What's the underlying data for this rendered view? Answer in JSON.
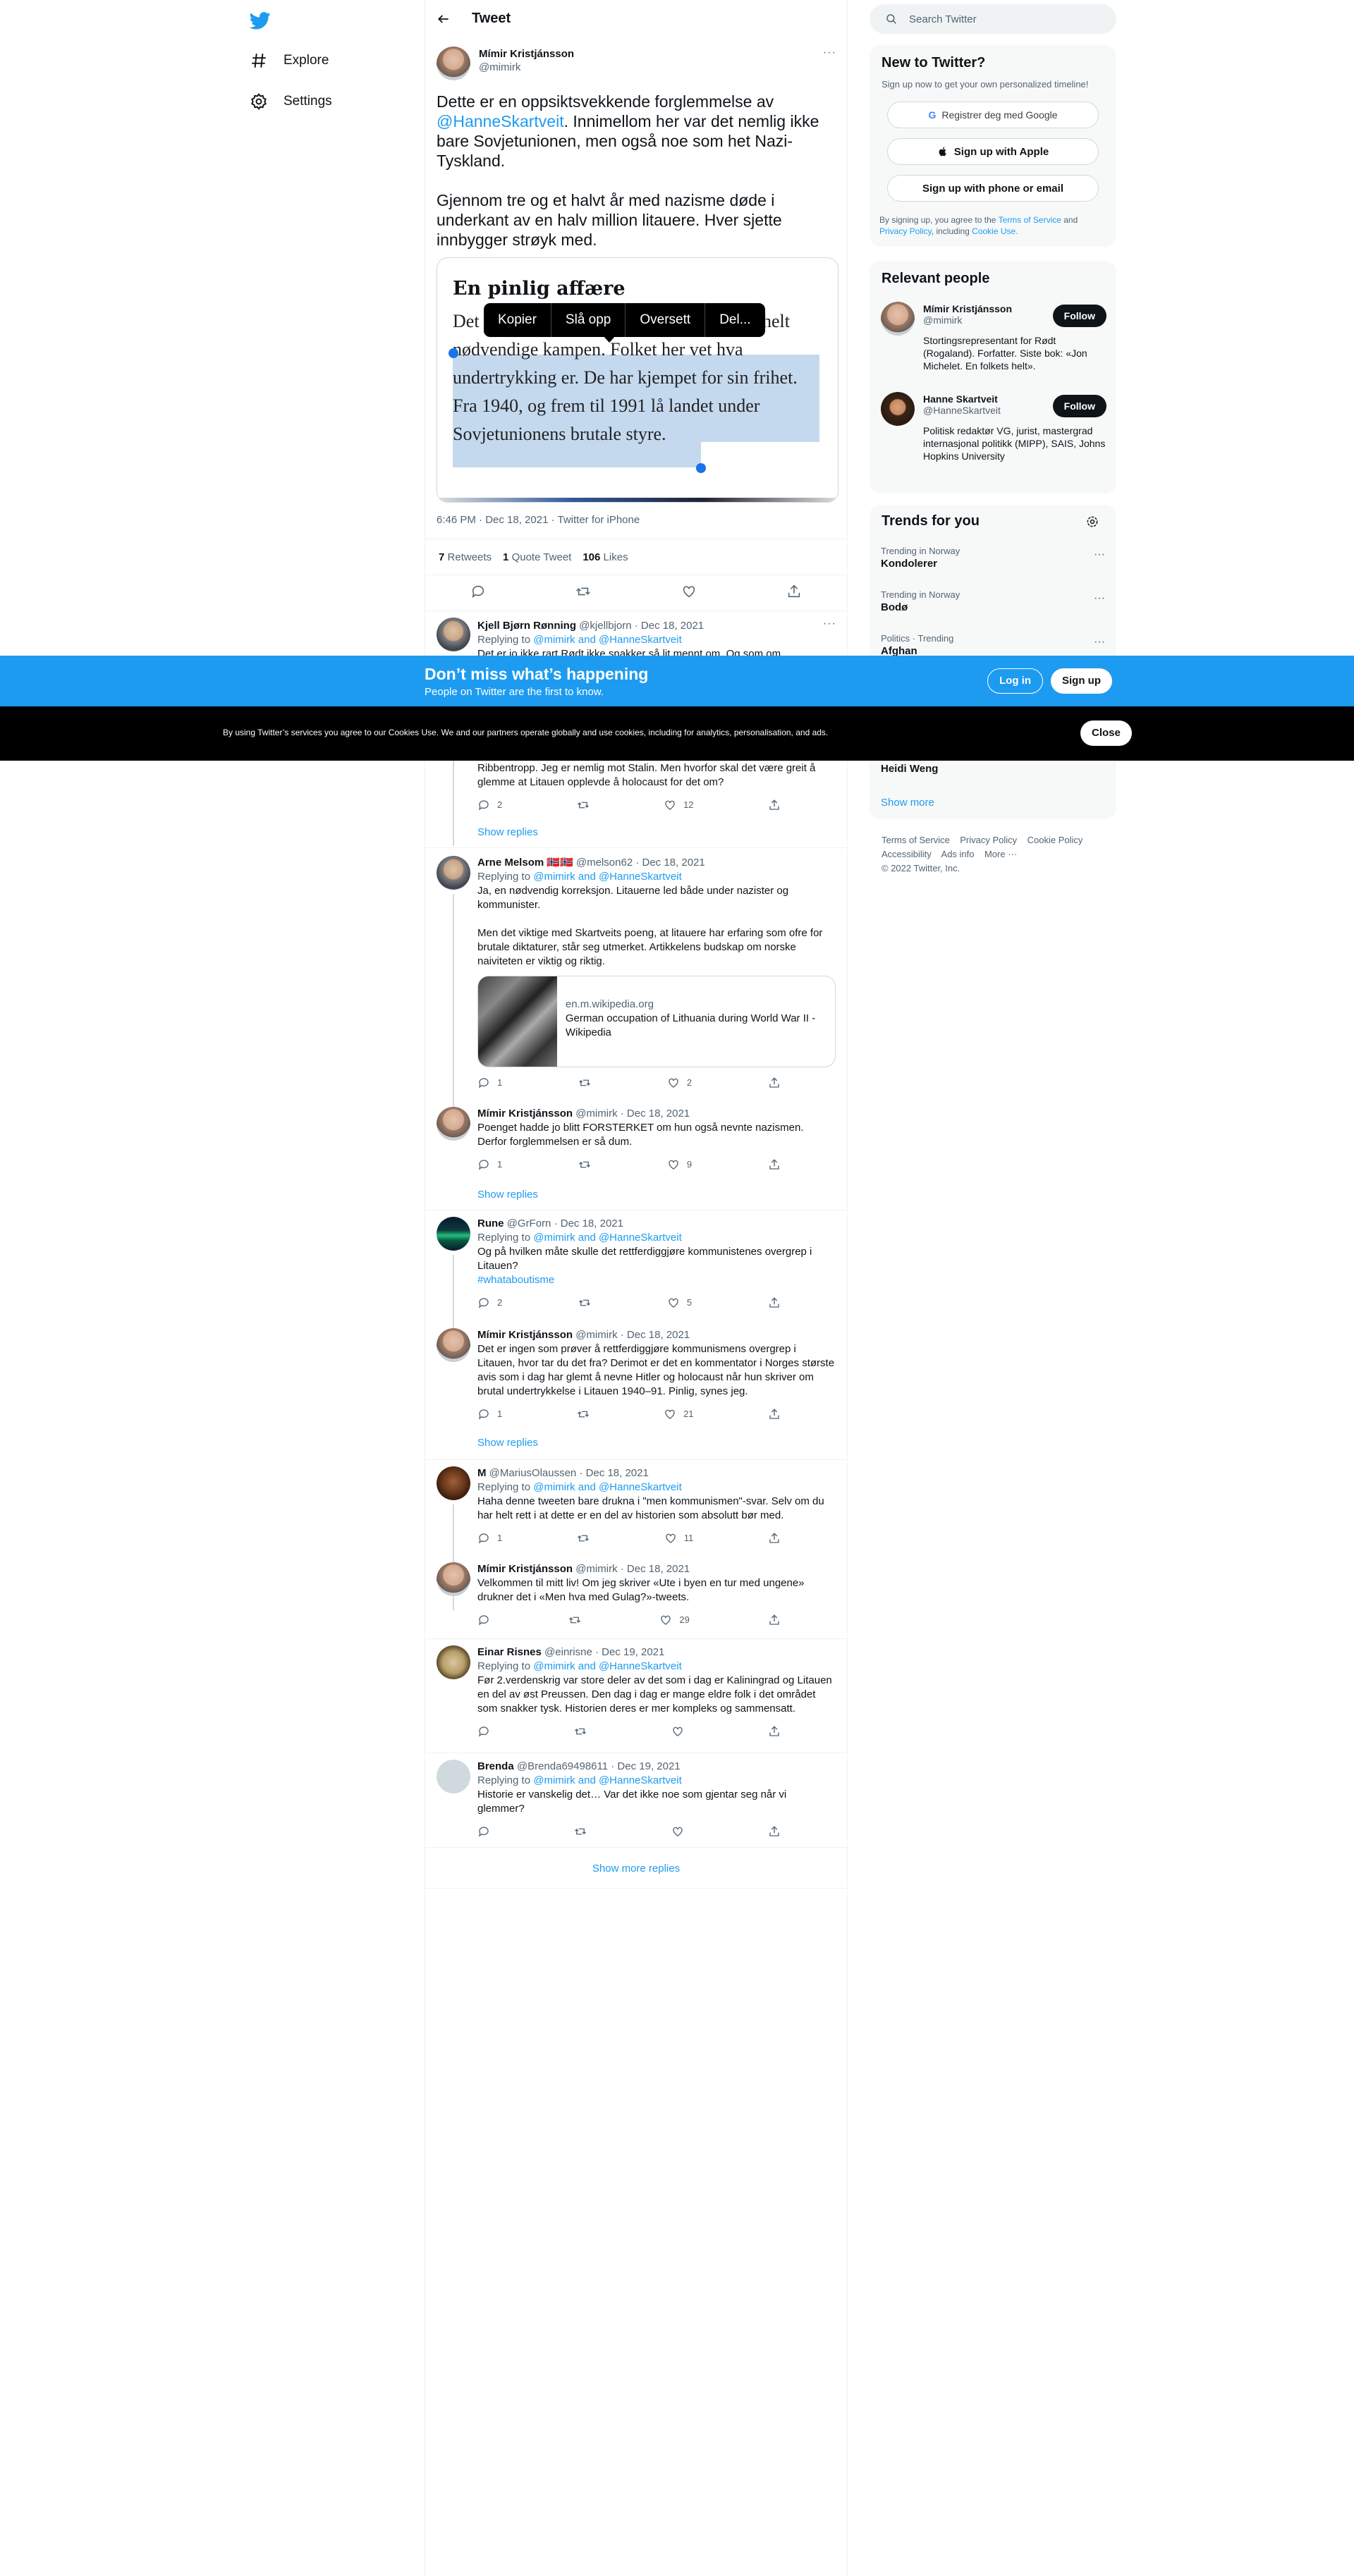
{
  "nav": {
    "explore": "Explore",
    "settings": "Settings"
  },
  "header": {
    "title": "Tweet"
  },
  "tweet": {
    "author": "Mímir Kristjánsson",
    "handle": "@mimirk",
    "text_1_a": "Dette er en oppsiktsvekkende forglemmelse av ",
    "text_1_link": "@HanneSkartveit",
    "text_1_b": ". Innimellom her var det nemlig ikke bare Sovjetunionen, men også noe som het Nazi-Tyskland.",
    "text_2": "Gjennom tre og et halvt år med nazisme døde i underkant av en halv million litauere. Hver sjette innbygger strøyk med.",
    "card_title": "En pinlig affære",
    "card_body_1": "Det er Litauen, ikke Ukraina, som tar den helt nødvendige kampen.",
    "card_body_2": "Folket her vet hva undertrykking er. De har kjempet for sin frihet. Fra 1940, og frem til 1991 lå landet under Sovjetunionens brutale styre.",
    "context_menu": [
      "Kopier",
      "Slå opp",
      "Oversett",
      "Del..."
    ],
    "meta": "6:46 PM · Dec 18, 2021 · Twitter for iPhone",
    "retweets": "7",
    "retweets_label": "Retweets",
    "quotes": "1",
    "quotes_label": "Quote Tweet",
    "likes": "106",
    "likes_label": "Likes"
  },
  "replies": [
    {
      "name": "Kjell Bjørn Rønning",
      "handle": "@kjellbjorn · Dec 18, 2021",
      "replying": "Replying to ",
      "to": "@mimirk and @HanneSkartveit",
      "text": "Det er jo ikke rart Rødt ikke snakker så lit mennt om. Og som om"
    },
    {
      "name": "",
      "handle": "",
      "text": "Ribbentropp. Jeg er nemlig mot Stalin. Men hvorfor skal det være greit å glemme at Litauen opplevde å holocaust for det om?",
      "reply": "2",
      "like": "12",
      "show": "Show replies"
    },
    {
      "name": "Arne Melsom 🇳🇴🇳🇴",
      "handle": "@melson62 · Dec 18, 2021",
      "replying": "Replying to ",
      "to": "@mimirk and @HanneSkartveit",
      "text": "Ja, en nødvendig korreksjon. Litauerne led både under nazister og kommunister.",
      "text2": "Men det viktige med Skartveits poeng, at litauere har erfaring som ofre for brutale diktaturer, står seg utmerket. Artikkelens budskap om norske naiviteten er viktig og riktig.",
      "card_domain": "en.m.wikipedia.org",
      "card_title": "German occupation of Lithuania during World War II - Wikipedia",
      "reply": "1",
      "like": "2"
    },
    {
      "name": "Mímir Kristjánsson",
      "handle": "@mimirk · Dec 18, 2021",
      "text": "Poenget hadde jo blitt FORSTERKET om hun også nevnte nazismen. Derfor forglemmelsen er så dum.",
      "reply": "1",
      "like": "9",
      "show": "Show replies"
    },
    {
      "name": "Rune",
      "handle": "@GrForn · Dec 18, 2021",
      "replying": "Replying to ",
      "to": "@mimirk and @HanneSkartveit",
      "text": "Og på hvilken måte skulle det rettferdiggjøre kommunistenes overgrep i Litauen?",
      "tag": "#whataboutisme",
      "reply": "2",
      "like": "5"
    },
    {
      "name": "Mímir Kristjánsson",
      "handle": "@mimirk · Dec 18, 2021",
      "text": "Det er ingen som prøver å rettferdiggjøre kommunismens overgrep i Litauen, hvor tar du det fra? Derimot er det en kommentator i Norges største avis som i dag har glemt å nevne Hitler og holocaust når hun skriver om brutal undertrykkelse i Litauen 1940–91. Pinlig, synes jeg.",
      "reply": "1",
      "like": "21",
      "show": "Show replies"
    },
    {
      "name": "M",
      "handle": "@MariusOlaussen · Dec 18, 2021",
      "replying": "Replying to ",
      "to": "@mimirk and @HanneSkartveit",
      "text": "Haha denne tweeten bare drukna i \"men kommunismen\"-svar. Selv om du har helt rett i at dette er en del av historien som absolutt bør med.",
      "reply": "1",
      "like": "11"
    },
    {
      "name": "Mímir Kristjánsson",
      "handle": "@mimirk · Dec 18, 2021",
      "text": "Velkommen til mitt liv! Om jeg skriver «Ute i byen en tur med ungene» drukner det i «Men hva med Gulag?»-tweets.",
      "reply": "",
      "like": "29"
    },
    {
      "name": "Einar Risnes",
      "handle": "@einrisne · Dec 19, 2021",
      "replying": "Replying to ",
      "to": "@mimirk and @HanneSkartveit",
      "text": "Før 2.verdenskrig var store deler av det som i dag er Kaliningrad og Litauen en del av øst Preussen. Den dag i dag er mange eldre folk i det området som snakker tysk. Historien deres er mer kompleks og sammensatt.",
      "reply": "",
      "like": ""
    },
    {
      "name": "Brenda",
      "handle": "@Brenda69498611 · Dec 19, 2021",
      "replying": "Replying to ",
      "to": "@mimirk and @HanneSkartveit",
      "text": "Historie er vanskelig det… Var det ikke noe som gjentar seg når vi glemmer?",
      "reply": "",
      "like": ""
    }
  ],
  "show_more_replies": "Show more replies",
  "search": {
    "placeholder": "Search Twitter"
  },
  "new_to_twitter": {
    "title": "New to Twitter?",
    "subtitle": "Sign up now to get your own personalized timeline!",
    "google": "Registrer deg med Google",
    "apple": "Sign up with Apple",
    "phone": "Sign up with phone or email",
    "legal_1": "By signing up, you agree to the ",
    "terms": "Terms of Service",
    "legal_2": " and ",
    "privacy": "Privacy Policy",
    "legal_3": ", including ",
    "cookie": "Cookie Use."
  },
  "relevant": {
    "title": "Relevant people",
    "people": [
      {
        "name": "Mímir Kristjánsson",
        "handle": "@mimirk",
        "bio": "Stortingsrepresentant for Rødt (Rogaland). Forfatter. Siste bok: «Jon Michelet. En folkets helt».",
        "btn": "Follow"
      },
      {
        "name": "Hanne Skartveit",
        "handle": "@HanneSkartveit",
        "bio": "Politisk redaktør VG, jurist, mastergrad internasjonal politikk (MIPP), SAIS, Johns Hopkins University",
        "btn": "Follow"
      }
    ]
  },
  "trends": {
    "title": "Trends for you",
    "items": [
      {
        "sub": "Trending in Norway",
        "name": "Kondolerer"
      },
      {
        "sub": "Trending in Norway",
        "name": "Bodø"
      },
      {
        "sub": "Politics · Trending",
        "name": "Afghan"
      }
    ],
    "last": "Heidi Weng",
    "show_more": "Show more"
  },
  "footer": {
    "l1": "Terms of Service",
    "l2": "Privacy Policy",
    "l3": "Cookie Policy",
    "l4": "Accessibility",
    "l5": "Ads info",
    "l6": "More ···",
    "copy": "© 2022 Twitter, Inc."
  },
  "banner": {
    "title": "Don’t miss what’s happening",
    "sub": "People on Twitter are the first to know.",
    "login": "Log in",
    "signup": "Sign up"
  },
  "cookie_bar": {
    "text": "By using Twitter’s services you agree to our Cookies Use. We and our partners operate globally and use cookies, including for analytics, personalisation, and ads.",
    "close": "Close"
  },
  "colors": {
    "accent": "#1d9bf0",
    "text": "#0f1419",
    "secondary": "#536471"
  }
}
